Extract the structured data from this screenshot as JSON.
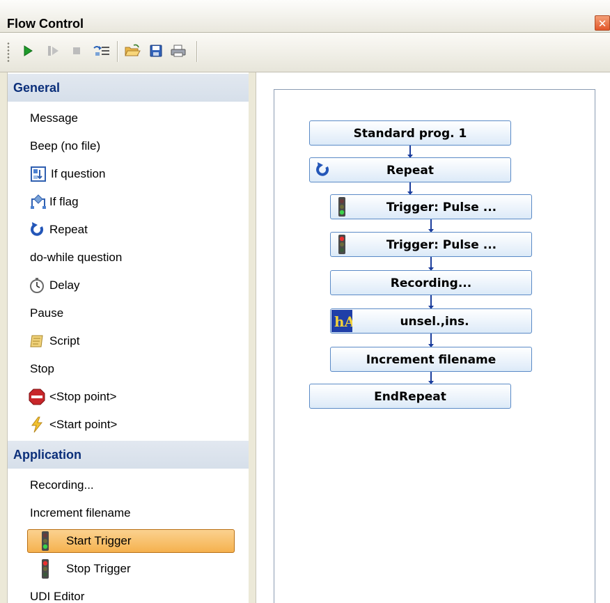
{
  "window": {
    "title": "Flow Control",
    "close_glyph": "✕"
  },
  "toolbar": {
    "buttons": [
      {
        "name": "run-button",
        "icon": "play-icon",
        "enabled": true
      },
      {
        "name": "step-button",
        "icon": "step-icon",
        "enabled": false
      },
      {
        "name": "stop-button",
        "icon": "stop-icon",
        "enabled": false
      },
      {
        "name": "list-button",
        "icon": "list-icon",
        "enabled": true
      },
      {
        "name": "open-button",
        "icon": "folder-open-icon",
        "enabled": true
      },
      {
        "name": "save-button",
        "icon": "floppy-disk-icon",
        "enabled": true
      },
      {
        "name": "print-button",
        "icon": "printer-icon",
        "enabled": true
      }
    ]
  },
  "palette": {
    "sections": [
      {
        "label": "General",
        "items": [
          {
            "label": "Message",
            "icon": null
          },
          {
            "label": "Beep (no file)",
            "icon": null
          },
          {
            "label": "If question",
            "icon": "if-question-icon"
          },
          {
            "label": "If flag",
            "icon": "if-flag-icon"
          },
          {
            "label": "Repeat",
            "icon": "repeat-icon"
          },
          {
            "label": "do-while question",
            "icon": null
          },
          {
            "label": "Delay",
            "icon": "stopwatch-icon"
          },
          {
            "label": "Pause",
            "icon": null
          },
          {
            "label": "Script",
            "icon": "scroll-icon"
          },
          {
            "label": "Stop",
            "icon": null
          },
          {
            "label": "<Stop point>",
            "icon": "stop-sign-icon"
          },
          {
            "label": "<Start point>",
            "icon": "lightning-icon"
          }
        ]
      },
      {
        "label": "Application",
        "items": [
          {
            "label": "Recording...",
            "icon": null
          },
          {
            "label": "Increment filename",
            "icon": null
          },
          {
            "label": "Start Trigger",
            "icon": "traffic-light-green-icon",
            "selected": true
          },
          {
            "label": "Stop Trigger",
            "icon": "traffic-light-red-icon"
          },
          {
            "label": "UDI Editor",
            "icon": null
          }
        ]
      }
    ]
  },
  "flow": {
    "nodes": [
      {
        "label": "Standard prog. 1",
        "icon": null
      },
      {
        "label": "Repeat",
        "icon": "repeat-icon"
      },
      {
        "label": "Trigger: Pulse ...",
        "icon": "traffic-light-green-icon"
      },
      {
        "label": "Trigger: Pulse ...",
        "icon": "traffic-light-red-icon"
      },
      {
        "label": "Recording...",
        "icon": null
      },
      {
        "label": "unsel.,ins.",
        "icon": "ha-icon"
      },
      {
        "label": "Increment filename",
        "icon": null
      },
      {
        "label": "EndRepeat",
        "icon": null
      }
    ]
  },
  "colors": {
    "section_header_text": "#0b2f7a",
    "selection_fill": "#f5b14e",
    "node_border": "#5a8ac6",
    "connector": "#1b3d9c"
  }
}
